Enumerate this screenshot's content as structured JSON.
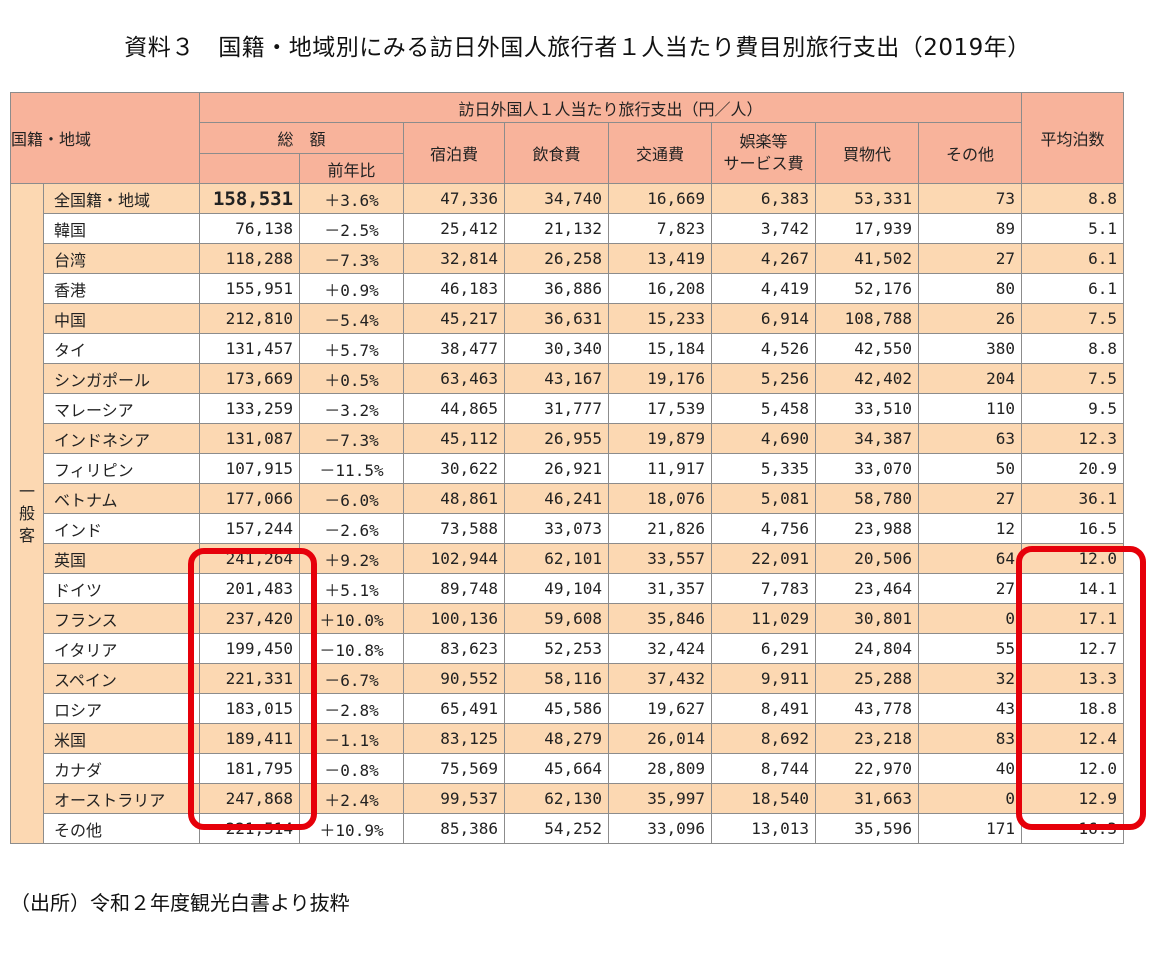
{
  "title": "資料３　国籍・地域別にみる訪日外国人旅行者１人当たり費目別旅行支出（2019年）",
  "source_note": "（出所）令和２年度観光白書より抜粋",
  "table": {
    "header": {
      "region": "国籍・地域",
      "spend_group": "訪日外国人１人当たり旅行支出（円／人）",
      "total": "総　額",
      "yoy": "前年比",
      "lodging": "宿泊費",
      "food": "飲食費",
      "transport": "交通費",
      "entertainment": "娯楽等\nサービス費",
      "shopping": "買物代",
      "other": "その他",
      "avg_nights": "平均泊数"
    },
    "group_label": "一般客",
    "rows": [
      {
        "name": "全国籍・地域",
        "total": "158,531",
        "yoy": "＋3.6%",
        "lodging": "47,336",
        "food": "34,740",
        "transport": "16,669",
        "entertainment": "6,383",
        "shopping": "53,331",
        "other": "73",
        "nights": "8.8"
      },
      {
        "name": "韓国",
        "total": "76,138",
        "yoy": "－2.5%",
        "lodging": "25,412",
        "food": "21,132",
        "transport": "7,823",
        "entertainment": "3,742",
        "shopping": "17,939",
        "other": "89",
        "nights": "5.1"
      },
      {
        "name": "台湾",
        "total": "118,288",
        "yoy": "－7.3%",
        "lodging": "32,814",
        "food": "26,258",
        "transport": "13,419",
        "entertainment": "4,267",
        "shopping": "41,502",
        "other": "27",
        "nights": "6.1"
      },
      {
        "name": "香港",
        "total": "155,951",
        "yoy": "＋0.9%",
        "lodging": "46,183",
        "food": "36,886",
        "transport": "16,208",
        "entertainment": "4,419",
        "shopping": "52,176",
        "other": "80",
        "nights": "6.1"
      },
      {
        "name": "中国",
        "total": "212,810",
        "yoy": "－5.4%",
        "lodging": "45,217",
        "food": "36,631",
        "transport": "15,233",
        "entertainment": "6,914",
        "shopping": "108,788",
        "other": "26",
        "nights": "7.5"
      },
      {
        "name": "タイ",
        "total": "131,457",
        "yoy": "＋5.7%",
        "lodging": "38,477",
        "food": "30,340",
        "transport": "15,184",
        "entertainment": "4,526",
        "shopping": "42,550",
        "other": "380",
        "nights": "8.8"
      },
      {
        "name": "シンガポール",
        "total": "173,669",
        "yoy": "＋0.5%",
        "lodging": "63,463",
        "food": "43,167",
        "transport": "19,176",
        "entertainment": "5,256",
        "shopping": "42,402",
        "other": "204",
        "nights": "7.5"
      },
      {
        "name": "マレーシア",
        "total": "133,259",
        "yoy": "－3.2%",
        "lodging": "44,865",
        "food": "31,777",
        "transport": "17,539",
        "entertainment": "5,458",
        "shopping": "33,510",
        "other": "110",
        "nights": "9.5"
      },
      {
        "name": "インドネシア",
        "total": "131,087",
        "yoy": "－7.3%",
        "lodging": "45,112",
        "food": "26,955",
        "transport": "19,879",
        "entertainment": "4,690",
        "shopping": "34,387",
        "other": "63",
        "nights": "12.3"
      },
      {
        "name": "フィリピン",
        "total": "107,915",
        "yoy": "－11.5%",
        "lodging": "30,622",
        "food": "26,921",
        "transport": "11,917",
        "entertainment": "5,335",
        "shopping": "33,070",
        "other": "50",
        "nights": "20.9"
      },
      {
        "name": "ベトナム",
        "total": "177,066",
        "yoy": "－6.0%",
        "lodging": "48,861",
        "food": "46,241",
        "transport": "18,076",
        "entertainment": "5,081",
        "shopping": "58,780",
        "other": "27",
        "nights": "36.1"
      },
      {
        "name": "インド",
        "total": "157,244",
        "yoy": "－2.6%",
        "lodging": "73,588",
        "food": "33,073",
        "transport": "21,826",
        "entertainment": "4,756",
        "shopping": "23,988",
        "other": "12",
        "nights": "16.5"
      },
      {
        "name": "英国",
        "total": "241,264",
        "yoy": "＋9.2%",
        "lodging": "102,944",
        "food": "62,101",
        "transport": "33,557",
        "entertainment": "22,091",
        "shopping": "20,506",
        "other": "64",
        "nights": "12.0"
      },
      {
        "name": "ドイツ",
        "total": "201,483",
        "yoy": "＋5.1%",
        "lodging": "89,748",
        "food": "49,104",
        "transport": "31,357",
        "entertainment": "7,783",
        "shopping": "23,464",
        "other": "27",
        "nights": "14.1"
      },
      {
        "name": "フランス",
        "total": "237,420",
        "yoy": "＋10.0%",
        "lodging": "100,136",
        "food": "59,608",
        "transport": "35,846",
        "entertainment": "11,029",
        "shopping": "30,801",
        "other": "0",
        "nights": "17.1"
      },
      {
        "name": "イタリア",
        "total": "199,450",
        "yoy": "－10.8%",
        "lodging": "83,623",
        "food": "52,253",
        "transport": "32,424",
        "entertainment": "6,291",
        "shopping": "24,804",
        "other": "55",
        "nights": "12.7"
      },
      {
        "name": "スペイン",
        "total": "221,331",
        "yoy": "－6.7%",
        "lodging": "90,552",
        "food": "58,116",
        "transport": "37,432",
        "entertainment": "9,911",
        "shopping": "25,288",
        "other": "32",
        "nights": "13.3"
      },
      {
        "name": "ロシア",
        "total": "183,015",
        "yoy": "－2.8%",
        "lodging": "65,491",
        "food": "45,586",
        "transport": "19,627",
        "entertainment": "8,491",
        "shopping": "43,778",
        "other": "43",
        "nights": "18.8"
      },
      {
        "name": "米国",
        "total": "189,411",
        "yoy": "－1.1%",
        "lodging": "83,125",
        "food": "48,279",
        "transport": "26,014",
        "entertainment": "8,692",
        "shopping": "23,218",
        "other": "83",
        "nights": "12.4"
      },
      {
        "name": "カナダ",
        "total": "181,795",
        "yoy": "－0.8%",
        "lodging": "75,569",
        "food": "45,664",
        "transport": "28,809",
        "entertainment": "8,744",
        "shopping": "22,970",
        "other": "40",
        "nights": "12.0"
      },
      {
        "name": "オーストラリア",
        "total": "247,868",
        "yoy": "＋2.4%",
        "lodging": "99,537",
        "food": "62,130",
        "transport": "35,997",
        "entertainment": "18,540",
        "shopping": "31,663",
        "other": "0",
        "nights": "12.9"
      },
      {
        "name": "その他",
        "total": "221,514",
        "yoy": "＋10.9%",
        "lodging": "85,386",
        "food": "54,252",
        "transport": "33,096",
        "entertainment": "13,013",
        "shopping": "35,596",
        "other": "171",
        "nights": "16.3"
      }
    ]
  },
  "highlight_color": "#e6000a",
  "header_color": "#f8b39b",
  "shade_color": "#fcd8b2"
}
